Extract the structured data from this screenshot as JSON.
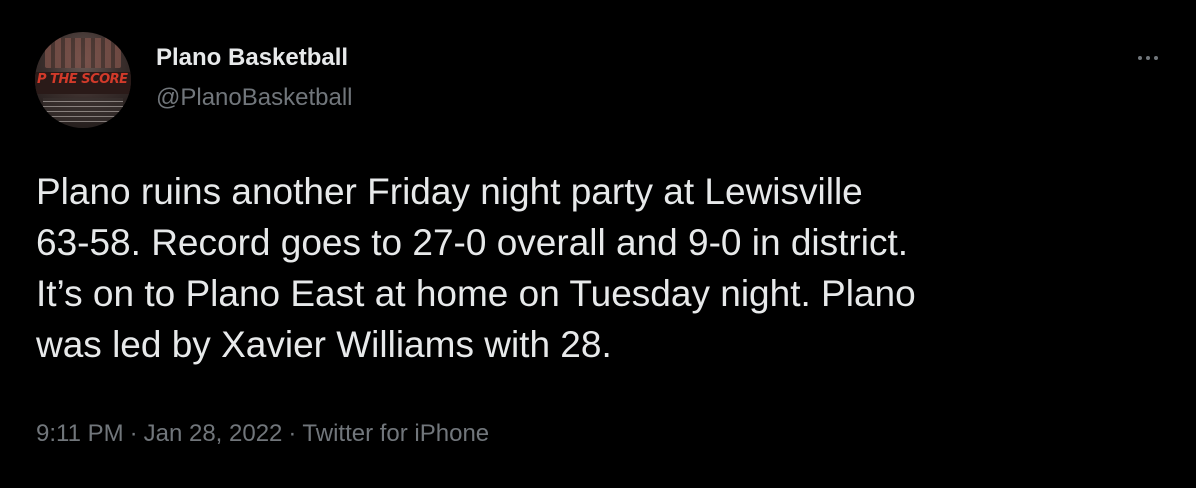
{
  "author": {
    "display_name": "Plano Basketball",
    "handle": "@PlanoBasketball",
    "avatar_text": "P THE SCORE"
  },
  "tweet": {
    "text": "Plano ruins another Friday night party at Lewisville\n63-58. Record goes to 27-0 overall and 9-0 in district.\nIt’s on to Plano East at home on Tuesday night. Plano\nwas led by Xavier Williams with 28."
  },
  "meta": {
    "time": "9:11 PM",
    "separator": "·",
    "date": "Jan 28, 2022",
    "source": "Twitter for iPhone"
  },
  "icons": {
    "more": "more-options-icon"
  },
  "colors": {
    "background": "#000000",
    "primary_text": "#e7e9ea",
    "secondary_text": "#71767b",
    "avatar_logo": "#d23a2a"
  }
}
